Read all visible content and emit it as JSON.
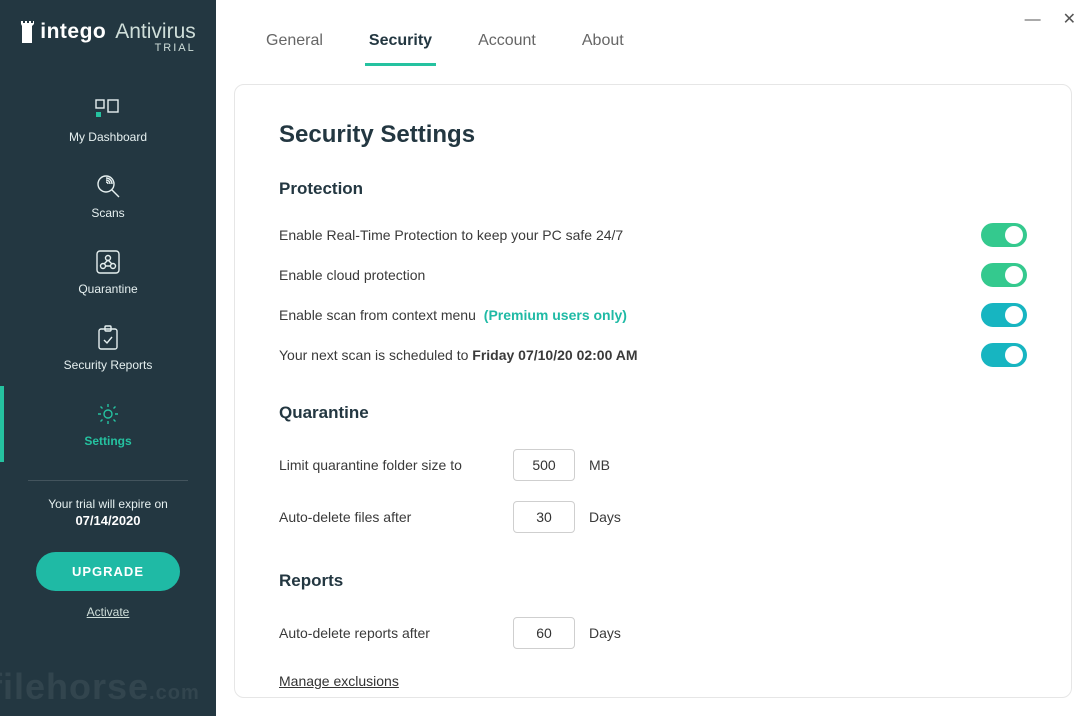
{
  "brand": {
    "name1": "intego",
    "name2": "Antivirus",
    "trial_tag": "TRIAL"
  },
  "sidebar": {
    "items": [
      {
        "label": "My Dashboard"
      },
      {
        "label": "Scans"
      },
      {
        "label": "Quarantine"
      },
      {
        "label": "Security Reports"
      },
      {
        "label": "Settings"
      }
    ],
    "trial_text": "Your trial will expire on",
    "trial_date": "07/14/2020",
    "upgrade": "UPGRADE",
    "activate": "Activate"
  },
  "tabs": [
    {
      "label": "General"
    },
    {
      "label": "Security"
    },
    {
      "label": "Account"
    },
    {
      "label": "About"
    }
  ],
  "page": {
    "title": "Security Settings",
    "protection": {
      "heading": "Protection",
      "row1": "Enable Real-Time Protection to keep your PC safe 24/7",
      "row2": "Enable cloud protection",
      "row3a": "Enable scan from context menu",
      "row3b": "(Premium users only)",
      "row4a": "Your next scan is scheduled to ",
      "row4b": "Friday 07/10/20 02:00 AM"
    },
    "quarantine": {
      "heading": "Quarantine",
      "limit_label": "Limit quarantine folder size to",
      "limit_value": "500",
      "limit_unit": "MB",
      "autodel_label": "Auto-delete files after",
      "autodel_value": "30",
      "autodel_unit": "Days"
    },
    "reports": {
      "heading": "Reports",
      "autodel_label": "Auto-delete reports after",
      "autodel_value": "60",
      "autodel_unit": "Days",
      "manage": "Manage exclusions"
    }
  },
  "watermark": {
    "a": "filehorse",
    "b": ".com"
  }
}
